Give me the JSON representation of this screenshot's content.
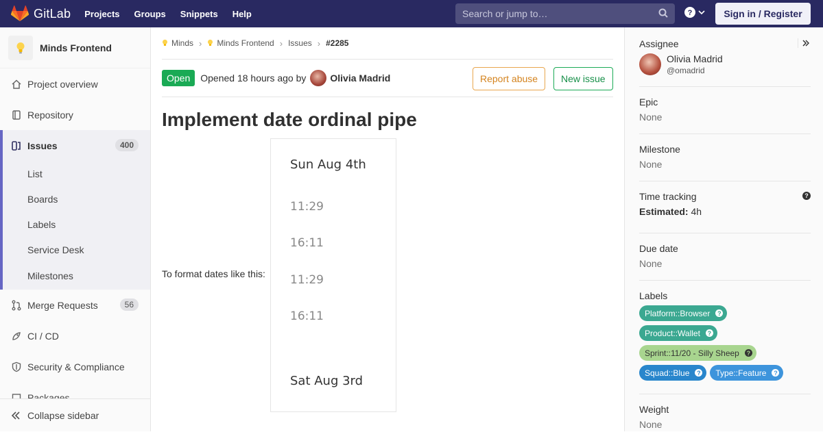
{
  "topnav": {
    "brand": "GitLab",
    "links": [
      "Projects",
      "Groups",
      "Snippets",
      "Help"
    ],
    "search_placeholder": "Search or jump to…",
    "signin": "Sign in / Register"
  },
  "sidebar": {
    "project_name": "Minds Frontend",
    "items": [
      {
        "label": "Project overview"
      },
      {
        "label": "Repository"
      },
      {
        "label": "Issues",
        "badge": "400"
      },
      {
        "label": "Merge Requests",
        "badge": "56"
      },
      {
        "label": "CI / CD"
      },
      {
        "label": "Security & Compliance"
      },
      {
        "label": "Packages"
      }
    ],
    "issues_sub": [
      "List",
      "Boards",
      "Labels",
      "Service Desk",
      "Milestones"
    ],
    "collapse": "Collapse sidebar"
  },
  "breadcrumb": [
    "Minds",
    "Minds Frontend",
    "Issues",
    "#2285"
  ],
  "issue": {
    "status": "Open",
    "opened_text": "Opened 18 hours ago by",
    "author": "Olivia Madrid",
    "report_abuse": "Report abuse",
    "new_issue": "New issue",
    "title": "Implement date ordinal pipe",
    "description": "To format dates like this:",
    "image": {
      "day1": "Sun Aug 4th",
      "times": [
        "11:29",
        "16:11",
        "11:29",
        "16:11"
      ],
      "day2": "Sat Aug 3rd"
    }
  },
  "rsidebar": {
    "assignee_title": "Assignee",
    "assignee_name": "Olivia Madrid",
    "assignee_handle": "@omadrid",
    "epic_title": "Epic",
    "epic_value": "None",
    "milestone_title": "Milestone",
    "milestone_value": "None",
    "time_title": "Time tracking",
    "time_label": "Estimated:",
    "time_value": "4h",
    "due_title": "Due date",
    "due_value": "None",
    "labels_title": "Labels",
    "labels": [
      {
        "text": "Platform::Browser",
        "color": "#3ba891",
        "fg": "#ffffff"
      },
      {
        "text": "Product::Wallet",
        "color": "#3ba891",
        "fg": "#ffffff"
      },
      {
        "text": "Sprint::11/20 - Silly Sheep",
        "color": "#a8d58f",
        "fg": "#333333"
      },
      {
        "text": "Squad::Blue",
        "color": "#2986cc",
        "fg": "#ffffff"
      },
      {
        "text": "Type::Feature",
        "color": "#3d94dc",
        "fg": "#ffffff"
      }
    ],
    "weight_title": "Weight",
    "weight_value": "None"
  }
}
